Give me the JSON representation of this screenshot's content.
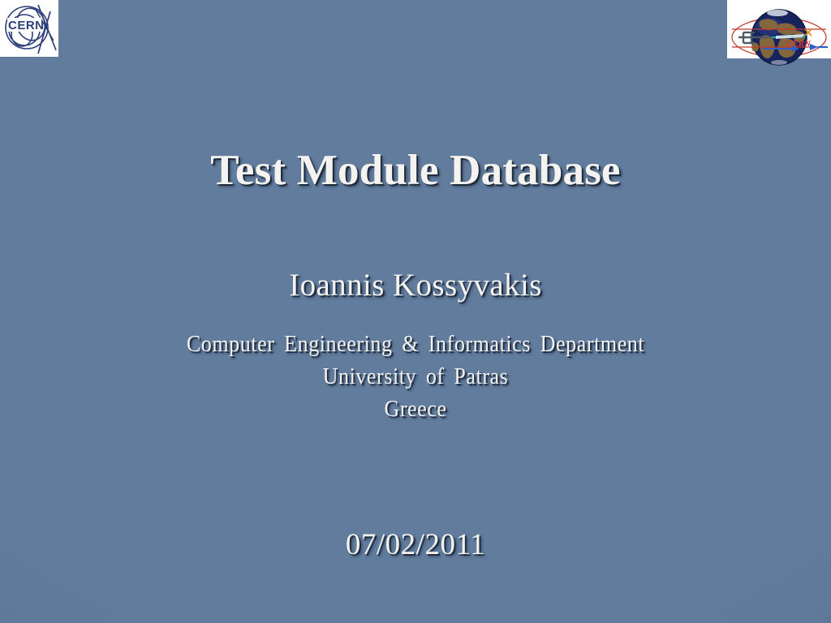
{
  "slide": {
    "title": "Test Module Database",
    "author": "Ioannis Kossyvakis",
    "affiliation": [
      "Computer  Engineering  &  Informatics  Department",
      "University  of  Patras",
      "Greece"
    ],
    "date": "07/02/2011",
    "background_color": "#627c9e",
    "text_color": "#f4f3ef",
    "shadow_color": "#162232"
  },
  "logos": {
    "top_left": {
      "name": "cern-logo",
      "text": "CERN",
      "color": "#2b3f7a",
      "background": "#ffffff"
    },
    "top_right": {
      "name": "globe-accelerator-logo",
      "text": "CERN",
      "globe_color": "#1c2a5e",
      "land_color": "#8a6a3c",
      "beamline_color": "#c0392b",
      "arrow_color": "#2b5fd0",
      "background": "#ffffff"
    }
  }
}
